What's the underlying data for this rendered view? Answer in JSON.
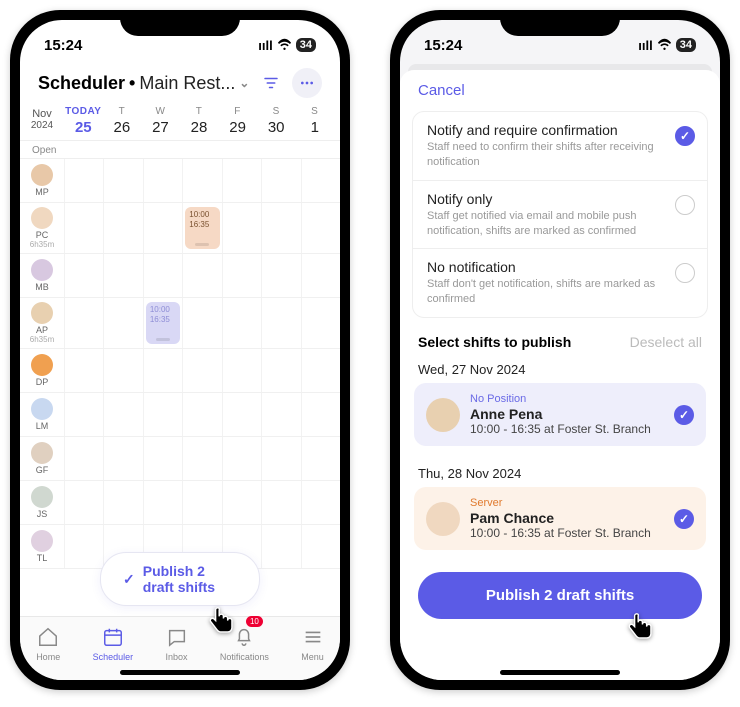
{
  "statusBar": {
    "time": "15:24",
    "battery": "34"
  },
  "left": {
    "header": {
      "title": "Scheduler",
      "separator": " • ",
      "location": "Main Rest..."
    },
    "monthLabel": "Nov",
    "yearLabel": "2024",
    "todayLabel": "TODAY",
    "days": [
      {
        "dow": "TODAY",
        "num": "25",
        "today": true
      },
      {
        "dow": "T",
        "num": "26"
      },
      {
        "dow": "W",
        "num": "27"
      },
      {
        "dow": "T",
        "num": "28"
      },
      {
        "dow": "F",
        "num": "29"
      },
      {
        "dow": "S",
        "num": "30"
      },
      {
        "dow": "S",
        "num": "1"
      }
    ],
    "openLabel": "Open",
    "employees": [
      {
        "initials": "MP",
        "hours": "",
        "avatar": "#e8c8a8"
      },
      {
        "initials": "PC",
        "hours": "6h35m",
        "avatar": "#f0d8c0",
        "shiftCol": 3,
        "shiftClass": "orange",
        "shiftStart": "10:00",
        "shiftEnd": "16:35"
      },
      {
        "initials": "MB",
        "hours": "",
        "avatar": "#d8c8e0"
      },
      {
        "initials": "AP",
        "hours": "6h35m",
        "avatar": "#e8d0b0",
        "shiftCol": 2,
        "shiftClass": "purple",
        "shiftStart": "10:00",
        "shiftEnd": "16:35"
      },
      {
        "initials": "DP",
        "hours": "",
        "avatar": "#f0a050"
      },
      {
        "initials": "LM",
        "hours": "",
        "avatar": "#c8d8f0"
      },
      {
        "initials": "GF",
        "hours": "",
        "avatar": "#e0d0c0"
      },
      {
        "initials": "JS",
        "hours": "",
        "avatar": "#d0d8d0"
      },
      {
        "initials": "TL",
        "hours": "",
        "avatar": "#e0d0e0"
      }
    ],
    "publishPill": "Publish 2 draft shifts",
    "tabs": [
      {
        "label": "Home"
      },
      {
        "label": "Scheduler",
        "active": true
      },
      {
        "label": "Inbox"
      },
      {
        "label": "Notifications",
        "badge": "10"
      },
      {
        "label": "Menu"
      }
    ]
  },
  "right": {
    "cancel": "Cancel",
    "options": [
      {
        "title": "Notify and require confirmation",
        "desc": "Staff need to confirm their shifts after receiving notification",
        "checked": true
      },
      {
        "title": "Notify only",
        "desc": "Staff get notified via email and mobile push notification, shifts are marked as confirmed",
        "checked": false
      },
      {
        "title": "No notification",
        "desc": "Staff don't get notification, shifts are marked as confirmed",
        "checked": false
      }
    ],
    "selectTitle": "Select shifts to publish",
    "deselect": "Deselect all",
    "groups": [
      {
        "date": "Wed, 27 Nov 2024",
        "card": {
          "bg": "purple-bg",
          "posClass": "pp",
          "position": "No Position",
          "name": "Anne Pena",
          "time": "10:00 - 16:35 at Foster St. Branch",
          "avatar": "#e8d0b0"
        }
      },
      {
        "date": "Thu, 28 Nov 2024",
        "card": {
          "bg": "orange-bg",
          "posClass": "oo",
          "position": "Server",
          "name": "Pam Chance",
          "time": "10:00 - 16:35 at Foster St. Branch",
          "avatar": "#f0d8c0"
        }
      }
    ],
    "publishBtn": "Publish 2 draft shifts"
  }
}
